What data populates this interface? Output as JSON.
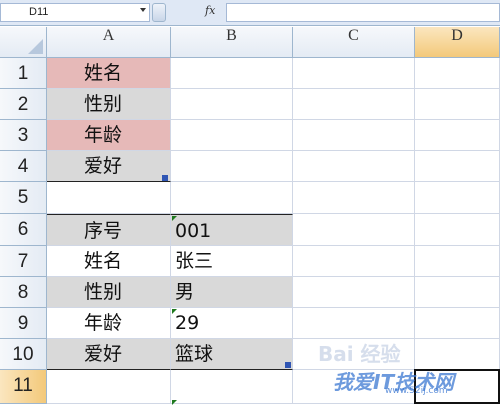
{
  "formula_bar": {
    "name_box": "D11",
    "fx_label": "fx",
    "formula": ""
  },
  "columns": [
    "A",
    "B",
    "C",
    "D"
  ],
  "rows": [
    "1",
    "2",
    "3",
    "4",
    "5",
    "6",
    "7",
    "8",
    "9",
    "10",
    "11"
  ],
  "cells": {
    "A1": "姓名",
    "A2": "性别",
    "A3": "年龄",
    "A4": "爱好",
    "A6": "序号",
    "B6": "001",
    "A7": "姓名",
    "B7": "张三",
    "A8": "性别",
    "B8": "男",
    "A9": "年龄",
    "B9": "29",
    "A10": "爱好",
    "B10": "篮球"
  },
  "colors": {
    "pink_fill": "#e6b9b8",
    "gray_fill": "#d9d9d9",
    "active_header": "#f3c97a"
  },
  "watermark": {
    "line1": "Bai 经验",
    "line2": "我爱IT技术网",
    "line3": "www.52ij.com"
  }
}
